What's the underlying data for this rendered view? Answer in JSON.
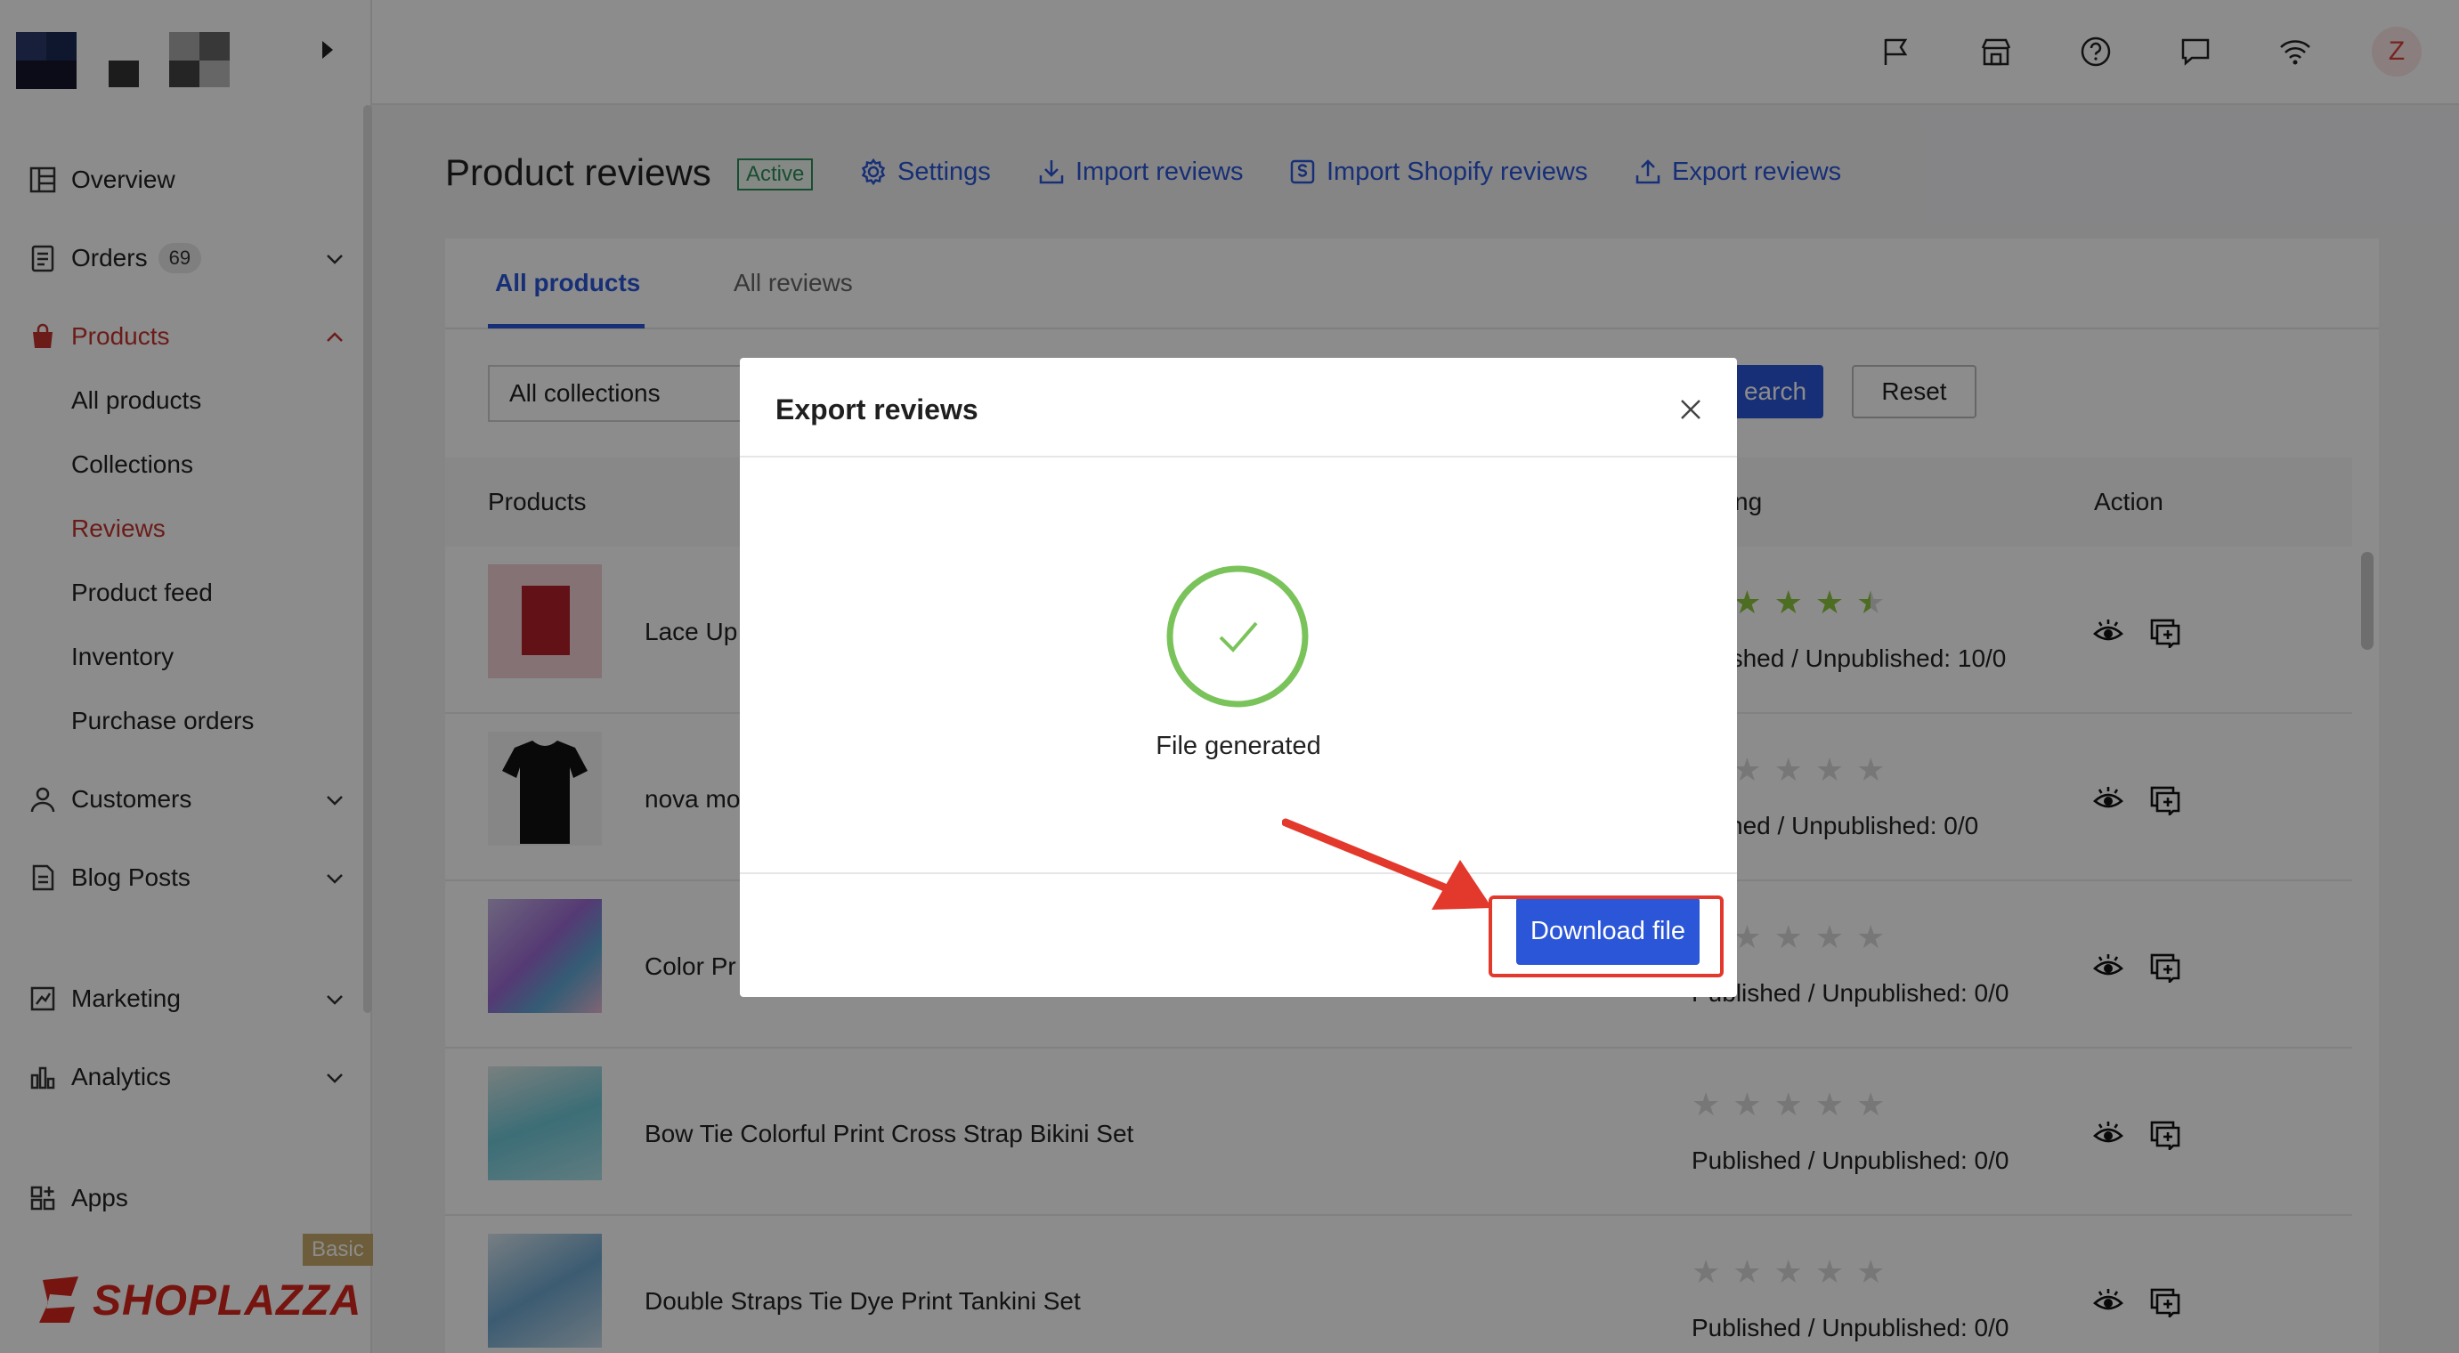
{
  "sidebar": {
    "items": [
      {
        "label": "Overview",
        "icon": "overview-icon"
      },
      {
        "label": "Orders",
        "badge": "69",
        "icon": "orders-icon"
      },
      {
        "label": "Products",
        "icon": "products-icon"
      },
      {
        "label": "Customers",
        "icon": "customers-icon"
      },
      {
        "label": "Blog Posts",
        "icon": "blog-icon"
      },
      {
        "label": "Marketing",
        "icon": "marketing-icon"
      },
      {
        "label": "Analytics",
        "icon": "analytics-icon"
      },
      {
        "label": "Apps",
        "icon": "apps-icon"
      }
    ],
    "products_sub": [
      "All products",
      "Collections",
      "Reviews",
      "Product feed",
      "Inventory",
      "Purchase orders"
    ],
    "active_sub": "Reviews",
    "brand": "SHOPLAZZA",
    "plan": "Basic"
  },
  "topbar": {
    "icons": [
      "flag-icon",
      "store-icon",
      "help-icon",
      "chat-icon",
      "wifi-icon"
    ],
    "avatar_initial": "Z"
  },
  "page": {
    "title": "Product reviews",
    "status": "Active",
    "links": [
      "Settings",
      "Import reviews",
      "Import Shopify reviews",
      "Export reviews"
    ]
  },
  "tabs": [
    "All products",
    "All reviews"
  ],
  "filters": {
    "collection_value": "All collections",
    "search_label": "earch",
    "reset_label": "Reset"
  },
  "table": {
    "headers": {
      "products": "Products",
      "rating": "ng",
      "action": "Action"
    },
    "rows": [
      {
        "name": "Lace Up",
        "rating": 4.5,
        "published": "ublished / Unpublished: 10/0"
      },
      {
        "name": "nova mo",
        "rating": 0,
        "published": "blished / Unpublished: 0/0"
      },
      {
        "name": "Color Pr",
        "rating": 0,
        "published": "Published / Unpublished: 0/0"
      },
      {
        "name": "Bow Tie Colorful Print Cross Strap Bikini Set",
        "rating": 0,
        "published": "Published / Unpublished: 0/0"
      },
      {
        "name": "Double Straps Tie Dye Print Tankini Set",
        "rating": 0,
        "published": "Published / Unpublished: 0/0"
      }
    ]
  },
  "modal": {
    "title": "Export reviews",
    "message": "File generated",
    "download_label": "Download file"
  },
  "colors": {
    "accent": "#2b56d8",
    "active_nav": "#c4332f",
    "success": "#7ac35a",
    "highlight": "#e3382c",
    "star": "#8cc63f"
  }
}
